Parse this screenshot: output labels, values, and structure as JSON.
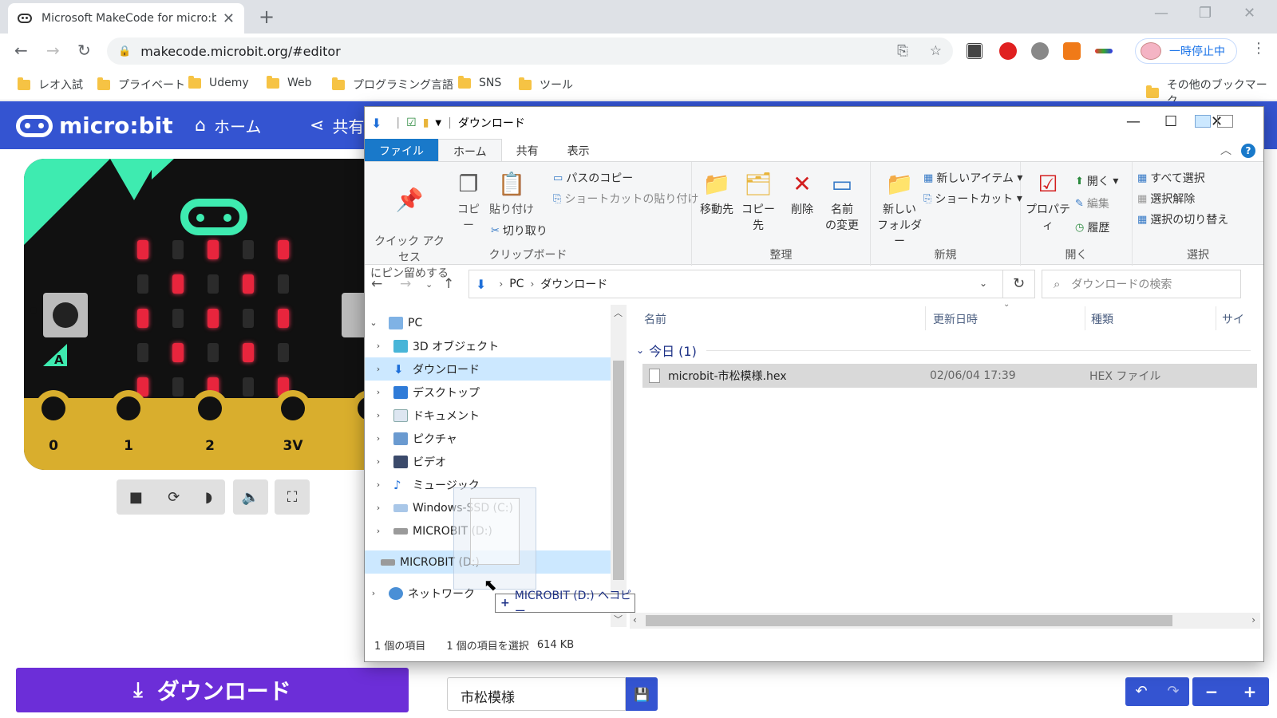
{
  "browser": {
    "tab_title": "Microsoft MakeCode for micro:bi",
    "url": "makecode.microbit.org/#editor",
    "profile_label": "一時停止中",
    "bookmarks": [
      "レオ入試",
      "プライベート",
      "Udemy",
      "Web",
      "プログラミング言語",
      "SNS",
      "ツール"
    ],
    "other_bookmarks": "その他のブックマーク"
  },
  "makecode": {
    "brand": "micro:bit",
    "nav_home": "ホーム",
    "nav_share": "共有",
    "download_label": "ダウンロード",
    "project_name": "市松模様",
    "pin_labels": [
      "0",
      "1",
      "2",
      "3V"
    ],
    "button_a_label": "A",
    "colors": {
      "header": "#3454d1",
      "download": "#6c2ed8",
      "led": "#e8253d",
      "accent": "#3eebb0"
    }
  },
  "explorer": {
    "title": "ダウンロード",
    "ribbon_tabs": [
      "ファイル",
      "ホーム",
      "共有",
      "表示"
    ],
    "clipboard": {
      "pin": "クイック アクセス\nにピン留めする",
      "copy": "コピー",
      "paste": "貼り付け",
      "copy_path": "パスのコピー",
      "paste_shortcut": "ショートカットの貼り付け",
      "cut": "切り取り",
      "group": "クリップボード"
    },
    "organize": {
      "move_to": "移動先",
      "copy_to": "コピー先",
      "delete": "削除",
      "rename_1": "名前",
      "rename_2": "の変更",
      "group": "整理"
    },
    "new": {
      "new_folder_1": "新しい",
      "new_folder_2": "フォルダー",
      "new_item": "新しいアイテム",
      "shortcut": "ショートカット",
      "group": "新規"
    },
    "open": {
      "properties": "プロパティ",
      "open": "開く",
      "edit": "編集",
      "history": "履歴",
      "group": "開く"
    },
    "select": {
      "select_all": "すべて選択",
      "select_none": "選択解除",
      "invert": "選択の切り替え",
      "group": "選択"
    },
    "path": [
      "PC",
      "ダウンロード"
    ],
    "search_placeholder": "ダウンロードの検索",
    "tree": [
      {
        "label": "PC",
        "expanded": true
      },
      {
        "label": "3D オブジェクト"
      },
      {
        "label": "ダウンロード",
        "selected": true
      },
      {
        "label": "デスクトップ"
      },
      {
        "label": "ドキュメント"
      },
      {
        "label": "ピクチャ"
      },
      {
        "label": "ビデオ"
      },
      {
        "label": "ミュージック"
      },
      {
        "label": "Windows-SSD (C:)"
      },
      {
        "label": "MICROBIT (D:)"
      },
      {
        "label": "MICROBIT (D:)",
        "drop_target": true
      },
      {
        "label": "ネットワーク"
      }
    ],
    "columns": [
      "名前",
      "更新日時",
      "種類",
      "サイ"
    ],
    "group_label": "今日 (1)",
    "file": {
      "name": "microbit-市松模様.hex",
      "date": "02/06/04 17:39",
      "type": "HEX ファイル"
    },
    "status_count": "1 個の項目",
    "status_selected": "1 個の項目を選択",
    "status_size": "614 KB",
    "drop_tip": "MICROBIT (D:) へコピー"
  }
}
